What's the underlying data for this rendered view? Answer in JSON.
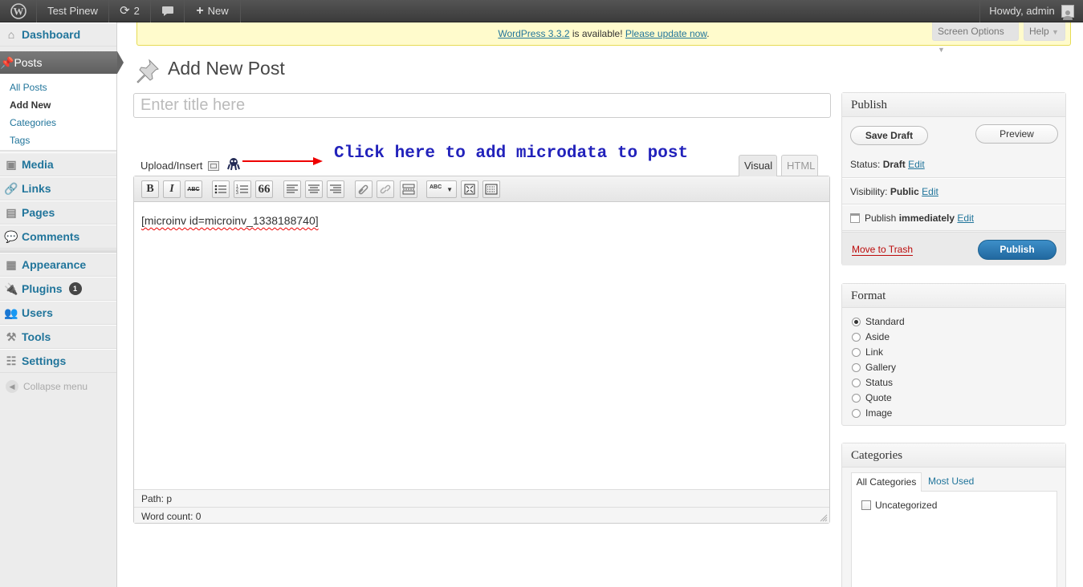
{
  "adminbar": {
    "site_name": "Test Pinew",
    "updates_count": "2",
    "new_label": "New",
    "howdy": "Howdy, admin"
  },
  "sidebar": {
    "dashboard": "Dashboard",
    "posts": "Posts",
    "submenu": [
      "All Posts",
      "Add New",
      "Categories",
      "Tags"
    ],
    "media": "Media",
    "links": "Links",
    "pages": "Pages",
    "comments": "Comments",
    "appearance": "Appearance",
    "plugins": "Plugins",
    "plugins_badge": "1",
    "users": "Users",
    "tools": "Tools",
    "settings": "Settings",
    "collapse": "Collapse menu"
  },
  "notice": {
    "version_link": "WordPress 3.3.2",
    "middle": " is available! ",
    "update_link": "Please update now",
    "end": "."
  },
  "screen_options": "Screen Options",
  "help": "Help",
  "page_title": "Add New Post",
  "title_placeholder": "Enter title here",
  "upload_insert": "Upload/Insert",
  "annotation": "Click here to add microdata to post",
  "tabs": {
    "visual": "Visual",
    "html": "HTML"
  },
  "toolbar": {
    "bold": "B",
    "italic": "I",
    "strike": "ABC",
    "quote": "66",
    "spell": "ABC"
  },
  "editor": {
    "content": "[microinv id=microinv_1338188740]",
    "path_label": "Path:",
    "path_value": "p",
    "word_count": "Word count: 0"
  },
  "publish": {
    "heading": "Publish",
    "save_draft": "Save Draft",
    "preview": "Preview",
    "status_label": "Status:",
    "status_value": "Draft",
    "visibility_label": "Visibility:",
    "visibility_value": "Public",
    "publish_label": "Publish",
    "publish_value": "immediately",
    "edit": "Edit",
    "trash": "Move to Trash",
    "publish_button": "Publish"
  },
  "format": {
    "heading": "Format",
    "options": [
      "Standard",
      "Aside",
      "Link",
      "Gallery",
      "Status",
      "Quote",
      "Image"
    ],
    "selected": "Standard"
  },
  "categories": {
    "heading": "Categories",
    "tab_all": "All Categories",
    "tab_most": "Most Used",
    "items": [
      "Uncategorized"
    ]
  },
  "colors": {
    "accent": "#21759b",
    "publish_blue": "#2a7fbd",
    "trash_red": "#bc0b0b",
    "annotation": "#2222bb"
  }
}
